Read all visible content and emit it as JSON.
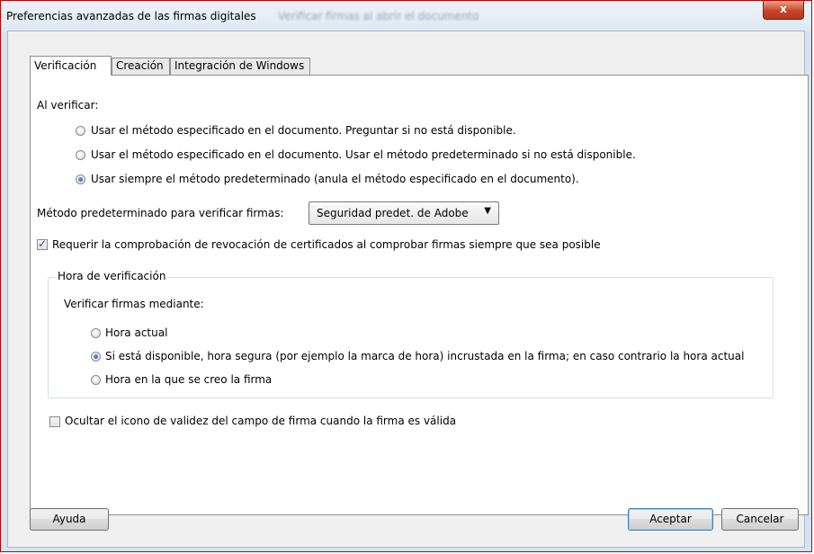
{
  "window": {
    "title": "Preferencias avanzadas de las firmas digitales",
    "ghost_title": "Verificar firmas al abrir el documento",
    "close_label": "x"
  },
  "tabs": [
    {
      "label": "Verificación",
      "active": true
    },
    {
      "label": "Creación",
      "active": false
    },
    {
      "label": "Integración de Windows",
      "active": false
    }
  ],
  "verify": {
    "heading": "Al verificar:",
    "options": [
      {
        "label": "Usar el método especificado en el documento. Preguntar si no está disponible.",
        "selected": false
      },
      {
        "label": "Usar el método especificado en el documento. Usar el método predeterminado si no está disponible.",
        "selected": false
      },
      {
        "label": "Usar siempre el método predeterminado (anula el método especificado en el documento).",
        "selected": true
      }
    ],
    "default_method_label": "Método predeterminado para verificar firmas:",
    "default_method_value": "Seguridad predet. de Adobe",
    "revocation_check_label": "Requerir la comprobación de revocación de certificados al comprobar firmas siempre que sea posible",
    "revocation_checked": true
  },
  "time": {
    "group_title": "Hora de verificación",
    "prompt": "Verificar firmas mediante:",
    "options": [
      {
        "label": "Hora actual",
        "selected": false
      },
      {
        "label": "Si está disponible, hora segura (por ejemplo la marca de hora) incrustada en la firma; en caso contrario la hora actual",
        "selected": true
      },
      {
        "label": "Hora en la que se creo la firma",
        "selected": false
      }
    ]
  },
  "hide_icon": {
    "label": "Ocultar el icono de validez del campo de firma cuando la firma es válida",
    "checked": false
  },
  "buttons": {
    "help": "Ayuda",
    "ok": "Aceptar",
    "cancel": "Cancelar"
  }
}
